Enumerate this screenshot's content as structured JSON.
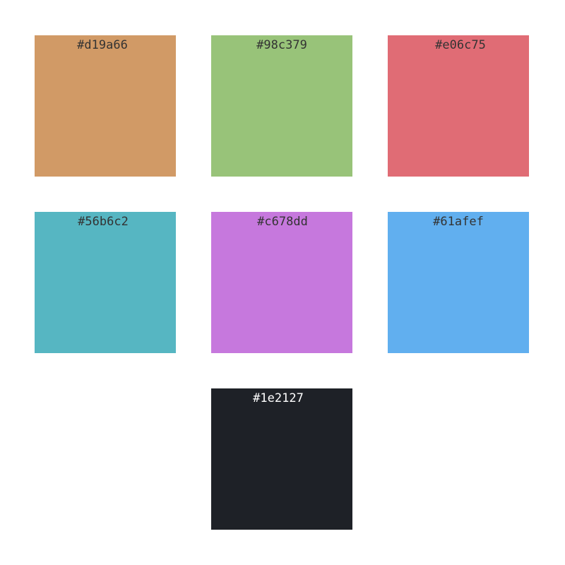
{
  "swatches": [
    {
      "label": "#d19a66",
      "color": "#d19a66",
      "text_color": "#333333"
    },
    {
      "label": "#98c379",
      "color": "#98c379",
      "text_color": "#333333"
    },
    {
      "label": "#e06c75",
      "color": "#e06c75",
      "text_color": "#333333"
    },
    {
      "label": "#56b6c2",
      "color": "#56b6c2",
      "text_color": "#333333"
    },
    {
      "label": "#c678dd",
      "color": "#c678dd",
      "text_color": "#333333"
    },
    {
      "label": "#61afef",
      "color": "#61afef",
      "text_color": "#333333"
    },
    {
      "label": "#1e2127",
      "color": "#1e2127",
      "text_color": "#ffffff"
    }
  ]
}
